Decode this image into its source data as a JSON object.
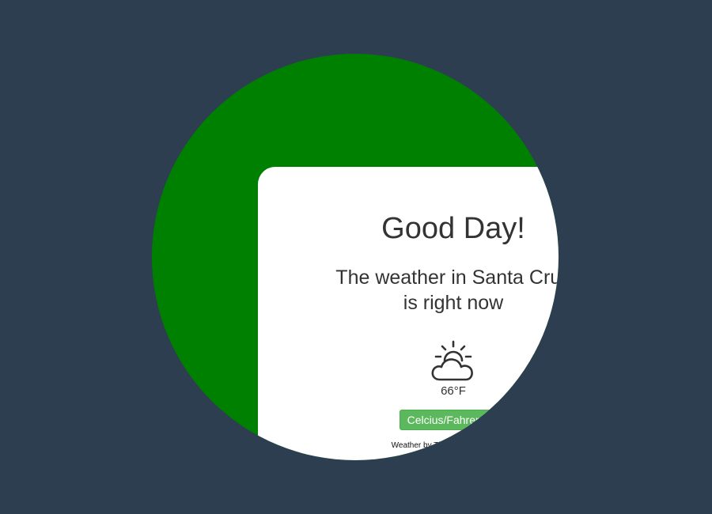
{
  "card": {
    "greeting": "Good Day!",
    "weather_line_1": "The weather in Santa Cruz",
    "weather_line_2": "is right now",
    "temperature": "66°F",
    "toggle_button_label": "Celcius/Fahrenheit",
    "credit": "Weather by The Weather Company"
  },
  "icons": {
    "weather": "partly-cloudy-day-icon"
  },
  "colors": {
    "page_background": "#2c3e50",
    "circle_background": "#008000",
    "card_background": "#ffffff",
    "button_background": "#5cb85c",
    "text": "#333333"
  }
}
